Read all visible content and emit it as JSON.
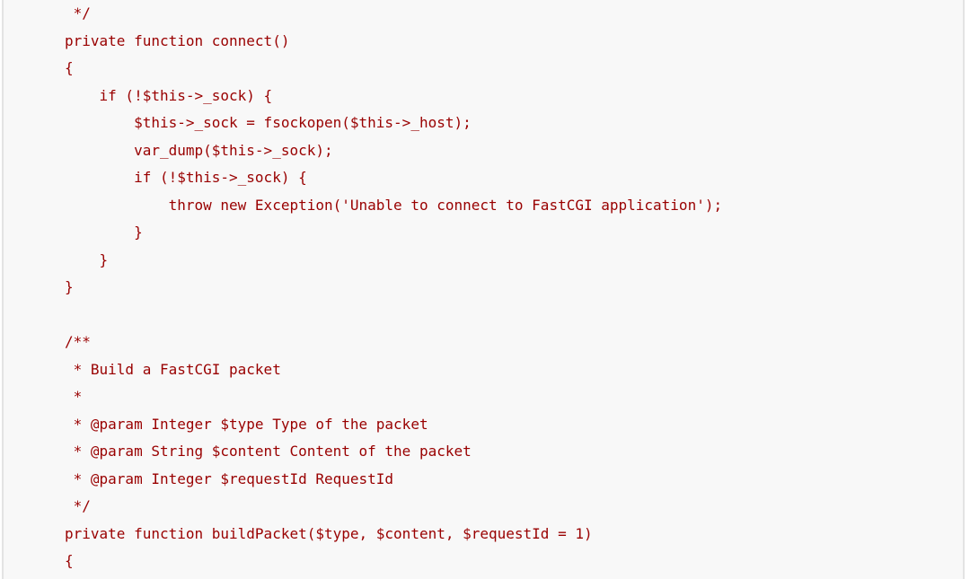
{
  "code": {
    "lines": [
      " */",
      "private function connect()",
      "{",
      "    if (!$this->_sock) {",
      "        $this->_sock = fsockopen($this->_host);",
      "        var_dump($this->_sock);",
      "        if (!$this->_sock) {",
      "            throw new Exception('Unable to connect to FastCGI application');",
      "        }",
      "    }",
      "}",
      "",
      "/**",
      " * Build a FastCGI packet",
      " *",
      " * @param Integer $type Type of the packet",
      " * @param String $content Content of the packet",
      " * @param Integer $requestId RequestId",
      " */",
      "private function buildPacket($type, $content, $requestId = 1)",
      "{"
    ]
  },
  "colors": {
    "code_text": "#990000",
    "panel_background": "#f8f8f8",
    "panel_border": "#e3e3e3"
  }
}
